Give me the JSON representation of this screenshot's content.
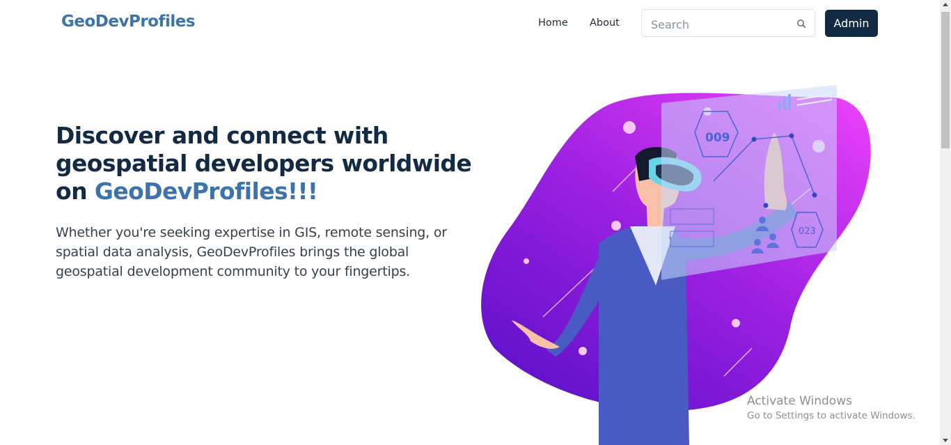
{
  "brand": {
    "name": "GeoDevProfiles",
    "color": "#3d73ad"
  },
  "nav": {
    "items": [
      {
        "label": "Home"
      },
      {
        "label": "About"
      }
    ],
    "search": {
      "placeholder": "Search",
      "value": "",
      "icon": "search-icon"
    },
    "admin_label": "Admin"
  },
  "hero": {
    "title_part1": "Discover and connect with geospatial developers worldwide on ",
    "title_accent": "GeoDevProfiles!!!",
    "description": "Whether you're seeking expertise in GIS, remote sensing, or spatial data analysis, GeoDevProfiles brings the global geospatial development community to your fingertips."
  },
  "illustration": {
    "hex_labels": [
      "009",
      "023"
    ],
    "blob_colors": [
      "#6a0fd0",
      "#e33ef7"
    ]
  },
  "watermark": {
    "title": "Activate Windows",
    "subtitle": "Go to Settings to activate Windows."
  },
  "colors": {
    "navy": "#132a44",
    "accent": "#3d73ad"
  }
}
